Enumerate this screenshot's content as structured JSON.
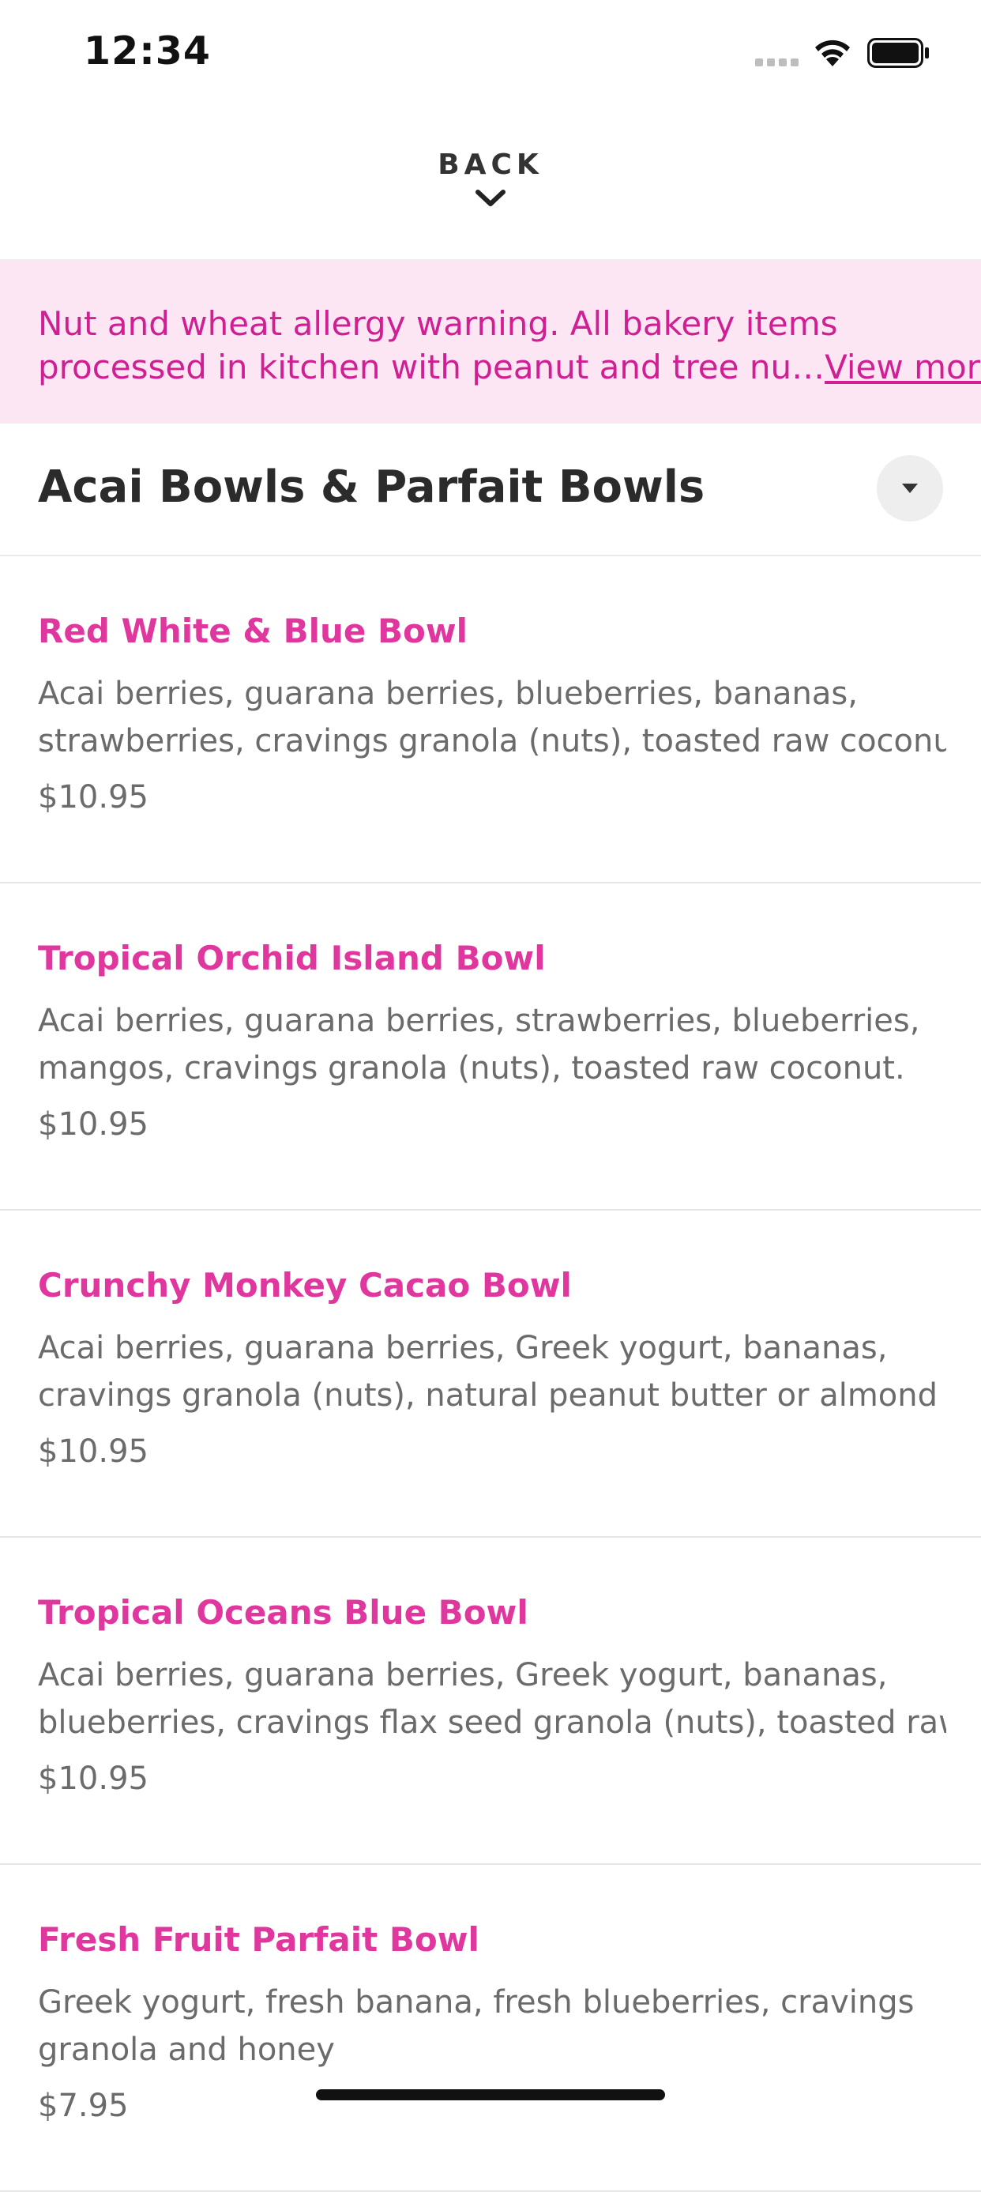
{
  "status_bar": {
    "time": "12:34",
    "icons": [
      "signal-icon",
      "wifi-icon",
      "battery-icon"
    ]
  },
  "nav": {
    "back_label": "BACK",
    "back_icon": "chevron-down-icon"
  },
  "allergy_banner": {
    "line1": "Nut and wheat allergy warning. All bakery items",
    "line2": "processed in kitchen with peanut and tree nu…",
    "view_more": "View more",
    "background": "#fce6f4",
    "text_color": "#cf1f93"
  },
  "section": {
    "title": "Acai Bowls & Parfait Bowls",
    "toggle_icon": "caret-down-icon"
  },
  "colors": {
    "accent": "#e0379f",
    "body_text": "#6b6b6b",
    "heading": "#2b2b2b"
  },
  "menu_items": [
    {
      "name": "Red White & Blue Bowl",
      "desc_line1": "Acai berries, guarana berries, blueberries, bananas,",
      "desc_line2": "strawberries, cravings granola (nuts), toasted raw coconut",
      "price": "$10.95"
    },
    {
      "name": "Tropical Orchid Island Bowl",
      "desc_line1": "Acai berries, guarana berries, strawberries, blueberries,",
      "desc_line2": "mangos, cravings granola (nuts), toasted raw coconut.",
      "price": "$10.95"
    },
    {
      "name": "Crunchy Monkey Cacao Bowl",
      "desc_line1": "Acai berries, guarana berries, Greek yogurt, bananas,",
      "desc_line2": "cravings granola (nuts), natural peanut butter or almond",
      "price": "$10.95"
    },
    {
      "name": "Tropical Oceans Blue Bowl",
      "desc_line1": "Acai berries, guarana berries, Greek yogurt, bananas,",
      "desc_line2": "blueberries, cravings flax seed granola (nuts), toasted raw",
      "price": "$10.95"
    },
    {
      "name": "Fresh Fruit Parfait Bowl",
      "desc_line1": "Greek yogurt, fresh banana, fresh blueberries, cravings",
      "desc_line2": "granola and honey",
      "price": "$7.95"
    }
  ]
}
